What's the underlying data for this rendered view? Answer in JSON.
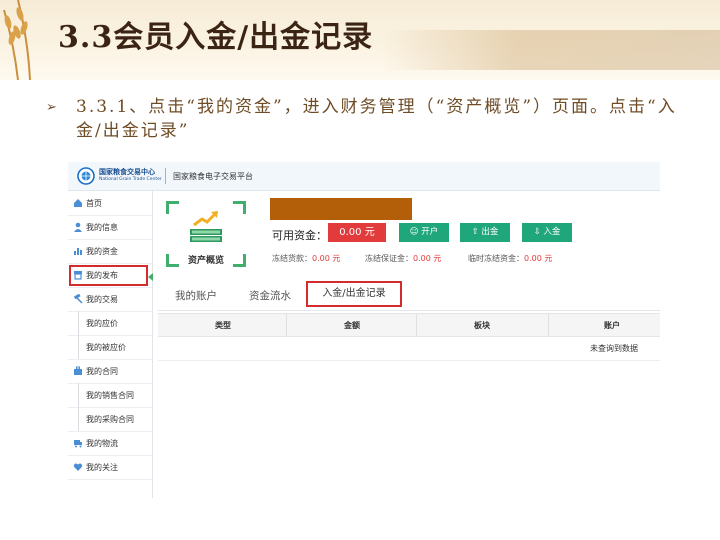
{
  "slide": {
    "title": "3.3会员入金/出金记录",
    "bullet_mark": "➢",
    "bullet_text": "3.3.1、点击“我的资金”，进入财务管理（“资产概览”）页面。点击“入金/出金记录”"
  },
  "app": {
    "logo_cn": "国家粮食交易中心",
    "logo_en": "National Grain Trade Center",
    "platform_title": "国家粮食电子交易平台"
  },
  "sidebar": {
    "items": [
      {
        "label": "首页",
        "icon": "home-icon"
      },
      {
        "label": "我的信息",
        "icon": "user-icon"
      },
      {
        "label": "我的资金",
        "icon": "chart-icon",
        "active": true
      },
      {
        "label": "我的发布",
        "icon": "store-icon"
      },
      {
        "label": "我的交易",
        "icon": "hammer-icon"
      },
      {
        "label": "我的应价",
        "sub": true
      },
      {
        "label": "我的被应价",
        "sub": true
      },
      {
        "label": "我的合同",
        "icon": "briefcase-icon"
      },
      {
        "label": "我的销售合同",
        "sub": true
      },
      {
        "label": "我的采购合同",
        "sub": true
      },
      {
        "label": "我的物流",
        "icon": "truck-icon"
      },
      {
        "label": "我的关注",
        "icon": "heart-icon"
      }
    ],
    "collapse_glyph": "«"
  },
  "account": {
    "overview_label": "资产概览",
    "available_label": "可用资金：",
    "available_value": "0.00 元",
    "buttons": {
      "open": "开户",
      "withdraw": "出金",
      "deposit": "入金"
    },
    "frozen_goods_label": "冻结货款：",
    "frozen_goods_value": "0.00 元",
    "frozen_margin_label": "冻结保证金：",
    "frozen_margin_value": "0.00 元",
    "temp_frozen_label": "临时冻结资金：",
    "temp_frozen_value": "0.00 元"
  },
  "tabs": [
    {
      "label": "我的账户"
    },
    {
      "label": "资金流水"
    },
    {
      "label": "入金/出金记录",
      "active": true
    }
  ],
  "table": {
    "columns": [
      "类型",
      "金额",
      "板块",
      "账户"
    ],
    "empty_text": "未查询到数据"
  },
  "colors": {
    "accent_green": "#1fa67a",
    "highlight_red": "#d42c2c",
    "value_red": "#e23b3b",
    "name_bar": "#b35f0a"
  }
}
